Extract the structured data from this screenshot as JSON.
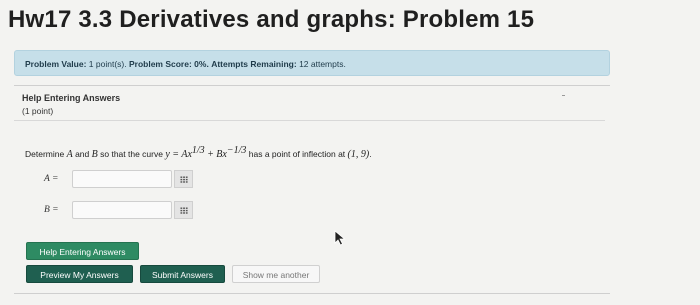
{
  "page": {
    "title": "Hw17 3.3 Derivatives and graphs: Problem 15"
  },
  "info_bar": {
    "value_label": "Problem Value:",
    "value": "1 point(s).",
    "score_label": "Problem Score:",
    "score": "0%.",
    "attempts_label": "Attempts Remaining:",
    "attempts": "12 attempts."
  },
  "help": {
    "title": "Help Entering Answers",
    "points": "(1 point)"
  },
  "question": {
    "text_before": "Determine",
    "var_a": "A",
    "and_text": "and",
    "var_b": "B",
    "text_mid": "so that the curve",
    "equation_lhs": "y = Ax",
    "exp1": "1/3",
    "plus": "+ Bx",
    "exp2": "−1/3",
    "text_after": "has a point of inflection at",
    "point": "(1, 9)",
    "period": "."
  },
  "answers": {
    "a_label": "A =",
    "a_value": "",
    "b_label": "B =",
    "b_value": ""
  },
  "buttons": {
    "help_entering": "Help Entering Answers",
    "preview": "Preview My Answers",
    "submit": "Submit Answers",
    "show_another": "Show me another"
  },
  "icons": {
    "answer_grid_a": "grid-icon",
    "answer_grid_b": "grid-icon",
    "cursor": "mouse-pointer-icon"
  }
}
